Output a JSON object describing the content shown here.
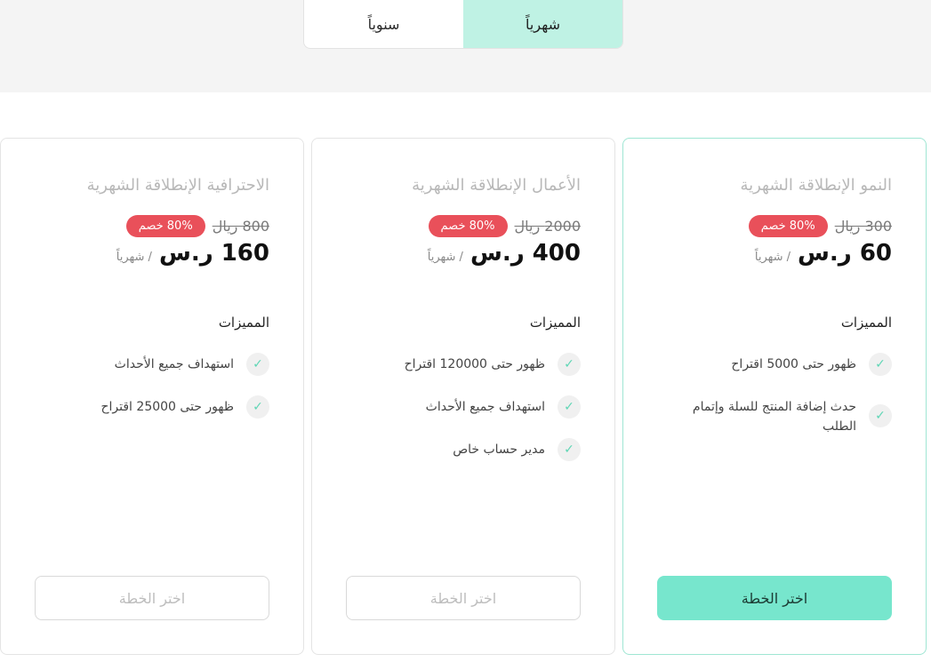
{
  "billing_toggle": {
    "monthly": "شهرياً",
    "yearly": "سنوياً",
    "selected": "monthly"
  },
  "plans": [
    {
      "title": "النمو الإنطلاقة الشهرية",
      "old_price": "300 ريال",
      "discount": "80% خصم",
      "price": "60 ر.س",
      "period": "/ شهرياً",
      "features_heading": "المميزات",
      "features": [
        "ظهور حتى 5000 اقتراح",
        "حدث إضافة المنتج للسلة وإتمام الطلب"
      ],
      "button": "اختر الخطة"
    },
    {
      "title": "الأعمال الإنطلاقة الشهرية",
      "old_price": "2000 ريال",
      "discount": "80% خصم",
      "price": "400 ر.س",
      "period": "/ شهرياً",
      "features_heading": "المميزات",
      "features": [
        "ظهور حتى 120000 اقتراح",
        "استهداف جميع الأحداث",
        "مدير حساب خاص"
      ],
      "button": "اختر الخطة"
    },
    {
      "title": "الاحترافية الإنطلاقة الشهرية",
      "old_price": "800 ريال",
      "discount": "80% خصم",
      "price": "160 ر.س",
      "period": "/ شهرياً",
      "features_heading": "المميزات",
      "features": [
        "استهداف جميع الأحداث",
        "ظهور حتى 25000 اقتراح"
      ],
      "button": "اختر الخطة"
    }
  ],
  "colors": {
    "accent": "#77e6cd",
    "toggle_active": "#bff2e4",
    "discount_badge": "#e9505a",
    "check": "#5fd6b5"
  },
  "icons": {
    "feature_check": "check-icon"
  }
}
